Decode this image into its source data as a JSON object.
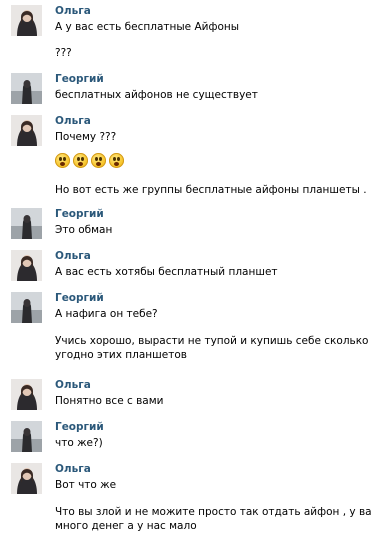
{
  "messages": [
    {
      "author": "Ольга",
      "avatar": "olga-avatar",
      "lines": [
        "А у вас есть бесплатные Айфоны",
        "???"
      ]
    },
    {
      "author": "Георгий",
      "avatar": "georgiy-avatar",
      "lines": [
        "бесплатных айфонов не существует"
      ]
    },
    {
      "author": "Ольга",
      "avatar": "olga-avatar",
      "lines": [
        "Почему ???",
        "Но вот есть же группы бесплатные айфоны планшеты ."
      ],
      "emoji": {
        "icon": "crying-face-icon",
        "count": 4
      }
    },
    {
      "author": "Георгий",
      "avatar": "georgiy-avatar",
      "lines": [
        "Это обман"
      ]
    },
    {
      "author": "Ольга",
      "avatar": "olga-avatar",
      "lines": [
        "А вас есть хотябы бесплатный планшет"
      ]
    },
    {
      "author": "Георгий",
      "avatar": "georgiy-avatar",
      "lines": [
        "А нафига он тебе?",
        "Учись хорошо, вырасти не тупой и купишь себе сколько",
        "угодно этих планшетов"
      ]
    },
    {
      "author": "Ольга",
      "avatar": "olga-avatar",
      "lines": [
        "Понятно все с вами"
      ]
    },
    {
      "author": "Георгий",
      "avatar": "georgiy-avatar",
      "lines": [
        "что же?)"
      ]
    },
    {
      "author": "Ольга",
      "avatar": "olga-avatar",
      "lines": [
        "Вот что же",
        "Что вы злой и не можите просто так отдать айфон , у вас",
        "много денег а у нас мало"
      ]
    }
  ],
  "colors": {
    "author": "#2b587a",
    "text": "#000000",
    "background": "#ffffff"
  }
}
